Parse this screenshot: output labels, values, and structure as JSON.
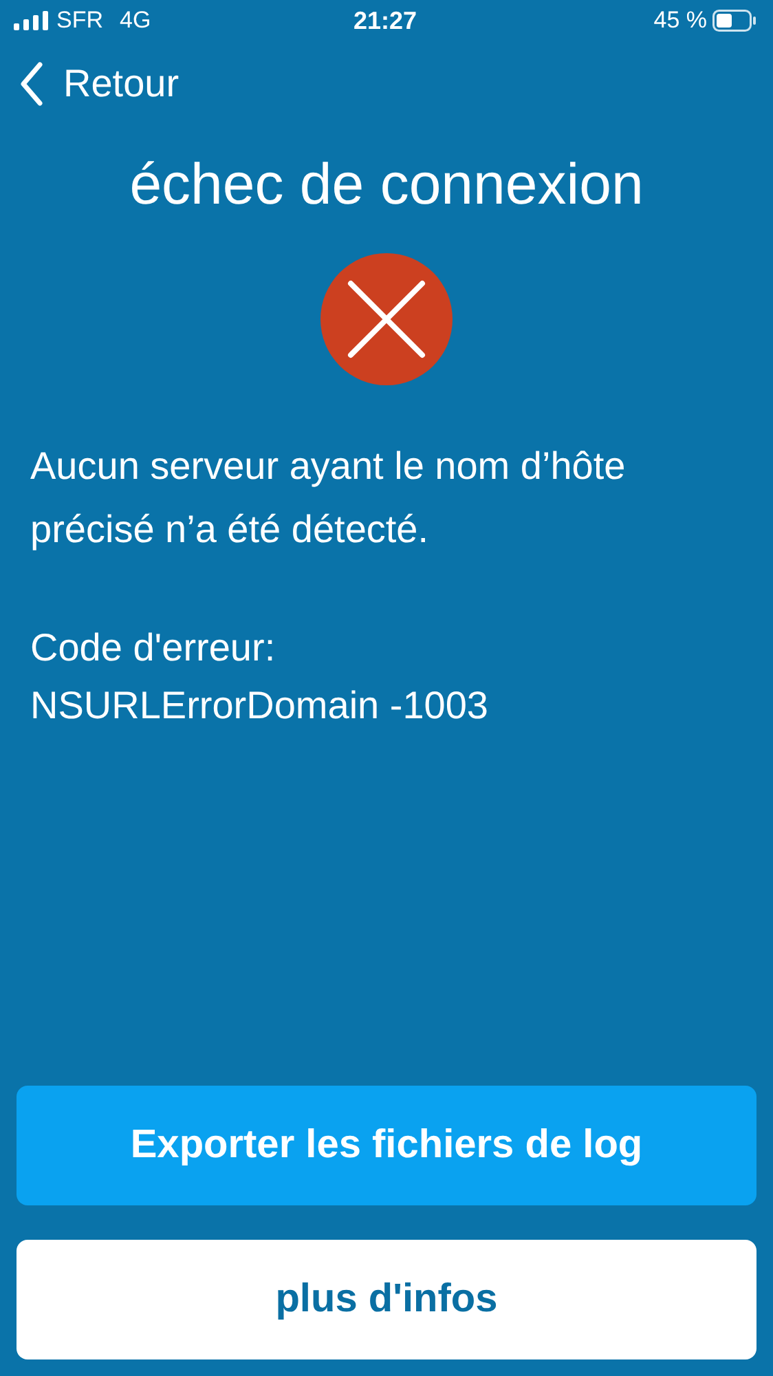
{
  "status_bar": {
    "carrier": "SFR",
    "network": "4G",
    "time": "21:27",
    "battery": "45 %"
  },
  "nav": {
    "back_label": "Retour"
  },
  "title": "échec de connexion",
  "message": "Aucun serveur ayant le nom d’hôte précisé n’a été détecté.",
  "error_code": {
    "label": "Code d'erreur:",
    "value": "NSURLErrorDomain -1003"
  },
  "buttons": [
    {
      "label": "Exporter les fichiers de log",
      "kind": "primary"
    },
    {
      "label": "plus d'infos",
      "kind": "secondary"
    }
  ]
}
